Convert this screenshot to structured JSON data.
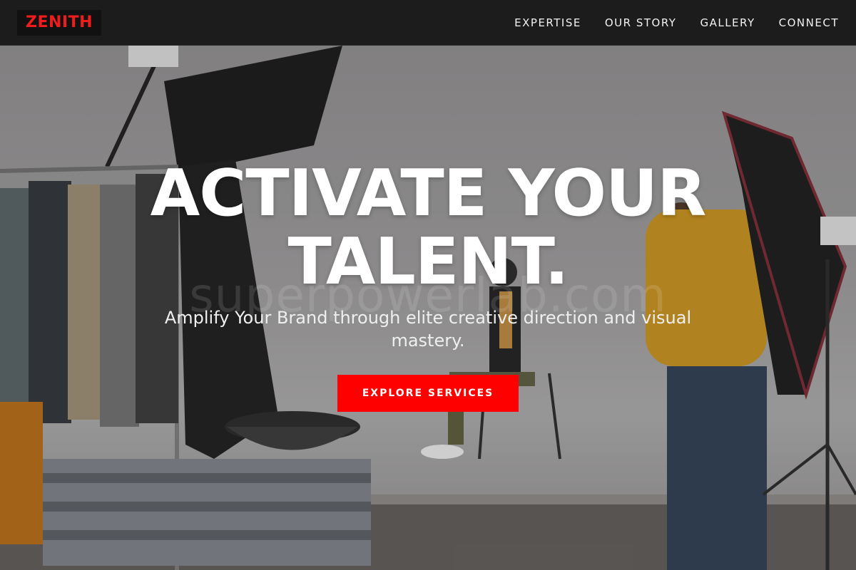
{
  "brand": {
    "logo": "ZENITH",
    "accent": "#ff0000"
  },
  "nav": {
    "items": [
      {
        "label": "EXPERTISE"
      },
      {
        "label": "OUR STORY"
      },
      {
        "label": "GALLERY"
      },
      {
        "label": "CONNECT"
      }
    ]
  },
  "hero": {
    "headline_line1": "ACTIVATE YOUR",
    "headline_line2": "TALENT.",
    "subhead": "Amplify Your Brand through elite creative direction and visual mastery.",
    "cta_label": "EXPLORE SERVICES",
    "watermark": "superpowerlab.com",
    "background": "photo-studio-scene"
  }
}
